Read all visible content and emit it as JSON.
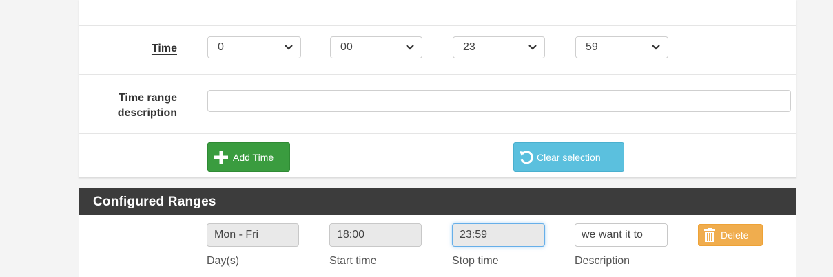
{
  "time_row": {
    "label": "Time",
    "start_hour": "0",
    "start_minute": "00",
    "stop_hour": "23",
    "stop_minute": "59"
  },
  "description_row": {
    "label": "Time range description",
    "value": ""
  },
  "buttons": {
    "add_time": "Add Time",
    "clear_selection": "Clear selection",
    "delete": "Delete"
  },
  "configured_ranges": {
    "title": "Configured Ranges",
    "rows": [
      {
        "days": "Mon - Fri",
        "start_time": "18:00",
        "stop_time": "23:59",
        "description": "we want it to"
      }
    ],
    "help": {
      "days": "Day(s)",
      "start_time": "Start time",
      "stop_time": "Stop time",
      "description": "Description"
    }
  },
  "colors": {
    "add_button": "#3a9c3f",
    "clear_button": "#5bc0de",
    "delete_button": "#f0ad4e",
    "section_bar": "#3c3c3c"
  },
  "icons": {
    "add_time": "plus-icon",
    "clear_selection": "undo-icon",
    "delete": "trash-icon",
    "select": "chevron-down-icon"
  }
}
